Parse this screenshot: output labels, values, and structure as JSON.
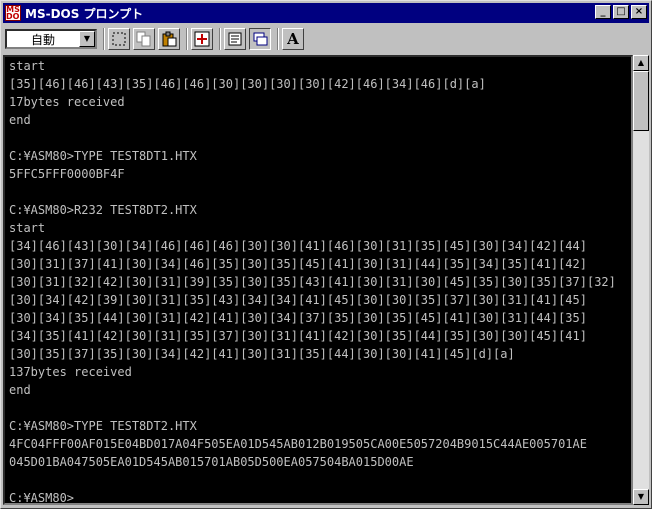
{
  "window": {
    "title": "MS-DOS プロンプト",
    "app_icon_label": "MS DOS",
    "minimize_glyph": "_",
    "maximize_glyph": "□",
    "close_glyph": "×"
  },
  "toolbar": {
    "font_size_value": "自動",
    "buttons": [
      {
        "name": "mark-icon"
      },
      {
        "name": "copy-icon"
      },
      {
        "name": "paste-icon"
      },
      {
        "name": "fullscreen-icon"
      },
      {
        "name": "properties-icon"
      },
      {
        "name": "background-icon"
      },
      {
        "name": "font-icon",
        "glyph": "A"
      }
    ]
  },
  "console": {
    "lines": [
      "start",
      "[35][46][46][43][35][46][46][30][30][30][30][42][46][34][46][d][a]",
      "17bytes received",
      "end",
      "",
      "C:¥ASM80>TYPE TEST8DT1.HTX",
      "5FFC5FFF0000BF4F",
      "",
      "C:¥ASM80>R232 TEST8DT2.HTX",
      "start",
      "[34][46][43][30][34][46][46][46][30][30][41][46][30][31][35][45][30][34][42][44]",
      "[30][31][37][41][30][34][46][35][30][35][45][41][30][31][44][35][34][35][41][42]",
      "[30][31][32][42][30][31][39][35][30][35][43][41][30][31][30][45][35][30][35][37][32]",
      "[30][34][42][39][30][31][35][43][34][34][41][45][30][30][35][37][30][31][41][45]",
      "[30][34][35][44][30][31][42][41][30][34][37][35][30][35][45][41][30][31][44][35]",
      "[34][35][41][42][30][31][35][37][30][31][41][42][30][35][44][35][30][30][45][41]",
      "[30][35][37][35][30][34][42][41][30][31][35][44][30][30][41][45][d][a]",
      "137bytes received",
      "end",
      "",
      "C:¥ASM80>TYPE TEST8DT2.HTX",
      "4FC04FFF00AF015E04BD017A04F505EA01D545AB012B019505CA00E5057204B9015C44AE005701AE",
      "045D01BA047505EA01D545AB015701AB05D500EA057504BA015D00AE",
      "",
      "C:¥ASM80>"
    ]
  }
}
